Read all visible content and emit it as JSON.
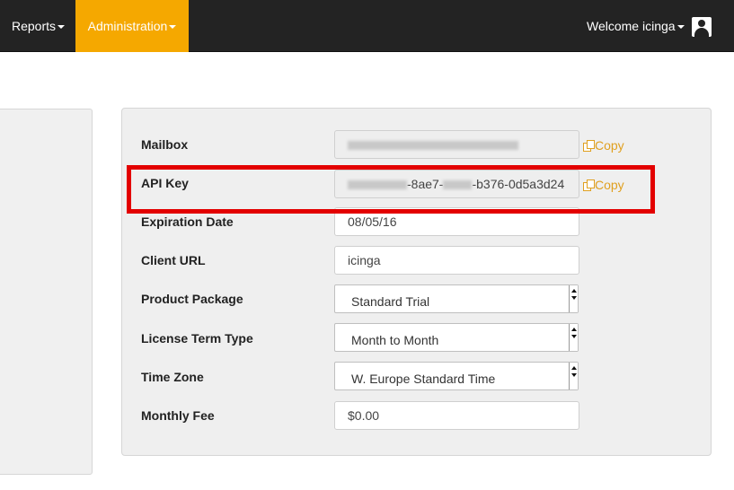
{
  "nav": {
    "reports_label": "Reports",
    "admin_label": "Administration",
    "welcome_label": "Welcome icinga"
  },
  "form": {
    "mailbox_label": "Mailbox",
    "api_key_label": "API Key",
    "api_key_value_visible": "-8ae7-",
    "api_key_value_tail": "-b376-0d5a3d24",
    "expiration_label": "Expiration Date",
    "expiration_value": "08/05/16",
    "client_url_label": "Client URL",
    "client_url_value": "icinga",
    "product_package_label": "Product Package",
    "product_package_value": "Standard Trial",
    "license_term_label": "License Term Type",
    "license_term_value": "Month to Month",
    "time_zone_label": "Time Zone",
    "time_zone_value": "W. Europe Standard Time",
    "monthly_fee_label": "Monthly Fee",
    "monthly_fee_value": "$0.00",
    "copy_label": "Copy"
  },
  "colors": {
    "navbar": "#232323",
    "accent": "#f5a800",
    "copy_link": "#e0a020",
    "highlight": "#e30000"
  },
  "icons": [
    "caret-down-icon",
    "user-avatar-icon",
    "copy-icon",
    "select-arrows-icon"
  ]
}
